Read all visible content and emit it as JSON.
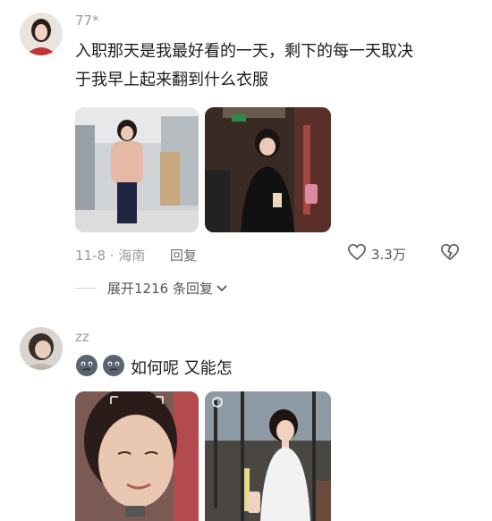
{
  "comment1": {
    "username": "77*",
    "text": "入职那天是我最好看的一天，剩下的每一天取决\n于我早上起来翻到什么衣服",
    "date_location": "11-8 · 海南",
    "reply_label": "回复",
    "likes": "3.3万",
    "expand_label": "展开1216 条回复"
  },
  "comment2": {
    "username": "zz",
    "text": "如何呢 又能怎"
  },
  "icons": {
    "heart": "heart-outline-icon",
    "dislike": "broken-heart-icon",
    "chevron": "chevron-down-icon",
    "emoji": "sad-face-emoji-icon"
  }
}
